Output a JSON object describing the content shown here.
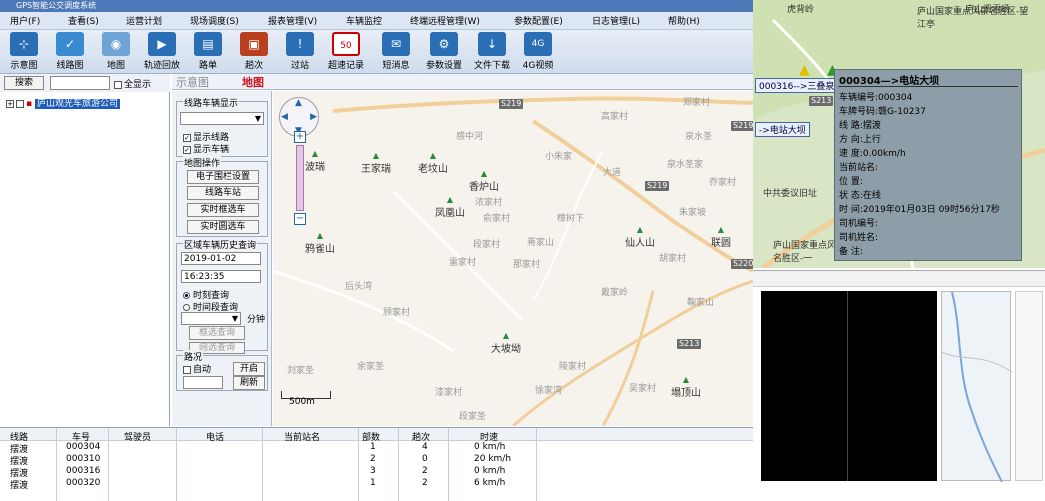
{
  "title": "GPS智能公交调度系统",
  "menu": [
    "用户(F)",
    "查看(S)",
    "运营计划",
    "现场调度(S)",
    "报表管理(V)",
    "车辆监控",
    "终端远程管理(W)",
    "参数配置(E)",
    "日志管理(L)",
    "帮助(H)"
  ],
  "toolbar": [
    "示意图",
    "线路图",
    "地图",
    "轨迹回放",
    "路单",
    "趟次",
    "过站",
    "超速记录",
    "短消息",
    "参数设置",
    "文件下载",
    "4G视频"
  ],
  "left": {
    "search_btn": "搜索",
    "show_all": "全显示",
    "tree_item": "庐山观光车旅游公司"
  },
  "tabs": [
    "示意图",
    "地图"
  ],
  "ctrl": {
    "route_group": "线路车辆显示",
    "show_route": "显示线路",
    "show_vehicle": "显示车辆",
    "map_ops": "地图操作",
    "fence_btn": "电子围栏设置",
    "line_vehicle_btn": "线路车站",
    "realtime_box_btn": "实时框选车",
    "realtime_circle_btn": "实时圆选车",
    "history_group": "区域车辆历史查询",
    "date": "2019-01-02",
    "time": "16:23:35",
    "radio_moment": "时刻查询",
    "radio_period": "时间段查询",
    "minutes": "分钟",
    "box_query": "框选查询",
    "circle_query": "圆选查询",
    "route_label": "路况",
    "auto": "自动",
    "open_btn": "开启",
    "refresh_btn": "刷新"
  },
  "map": {
    "scale": "500m",
    "places": [
      {
        "name": "王家瑞",
        "type": "mountain"
      },
      {
        "name": "老坟山",
        "type": "mountain"
      },
      {
        "name": "香炉山",
        "type": "mountain"
      },
      {
        "name": "凤凰山",
        "type": "mountain"
      },
      {
        "name": "鸦雀山",
        "type": "mountain"
      },
      {
        "name": "仙人山",
        "type": "mountain"
      },
      {
        "name": "大坡坳",
        "type": "mountain"
      },
      {
        "name": "塌顶山",
        "type": "mountain"
      },
      {
        "name": "联圆",
        "type": "town"
      },
      {
        "name": "波瑞",
        "type": "town"
      }
    ],
    "minor": [
      "感中河",
      "高家村",
      "郑家村",
      "泉水圣",
      "小朱家",
      "泉水圣家",
      "乔家村",
      "胡家村",
      "俞家村",
      "樟树下",
      "段家村",
      "雷家村",
      "那家村",
      "戴家岭",
      "蒋家山",
      "后头湾",
      "刘家圣",
      "余家圣",
      "漆家村",
      "陵家村",
      "段家圣",
      "大道",
      "浓家村",
      "徐家湾",
      "鞠家山",
      "朱家坡",
      "顾家村",
      "吴家村"
    ],
    "roads": [
      "S219",
      "S219",
      "S219",
      "S220",
      "S213"
    ]
  },
  "table": {
    "headers": [
      "线路",
      "车号",
      "驾驶员",
      "电话",
      "当前站名",
      "部数",
      "趟次",
      "时速"
    ],
    "rows": [
      [
        "摆渡",
        "000304",
        "",
        "",
        "",
        "1",
        "4",
        "0 km/h"
      ],
      [
        "摆渡",
        "000310",
        "",
        "",
        "",
        "2",
        "0",
        "20 km/h"
      ],
      [
        "摆渡",
        "000316",
        "",
        "",
        "",
        "3",
        "2",
        "0 km/h"
      ],
      [
        "摆渡",
        "000320",
        "",
        "",
        "",
        "1",
        "2",
        "6 km/h"
      ]
    ]
  },
  "rmap": {
    "labels": [
      "虎背岭",
      "庐山滑雪场",
      "庐山国家重点风景名胜区-望江亭",
      "000316-->三叠泉",
      "S213",
      "->电站大坝",
      "中共委议旧址",
      "庐山国家重点风景名胜区-一"
    ]
  },
  "popup": {
    "title": "000304—>电站大坝",
    "fields": [
      "车辆编号:000304",
      "车牌号码:赣G-10237",
      "线    路:摆渡",
      "方    向:上行",
      "速    度:0.00km/h",
      "当前站名:",
      "位    置:",
      "状    态:在线",
      "时    间:2019年01月03日 09时56分17秒",
      "司机编号:",
      "司机姓名:",
      "备    注:"
    ]
  }
}
